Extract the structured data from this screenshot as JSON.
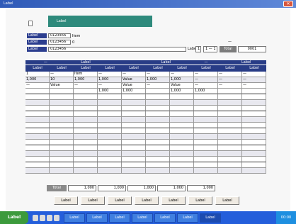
{
  "titlebar": {
    "title": "Label",
    "close_label": "✕"
  },
  "banner": {
    "text": "Label"
  },
  "fields": [
    {
      "label": "Label",
      "value": "0123456",
      "suffix": "Item"
    },
    {
      "label": "Label",
      "value": "0123456",
      "suffix": "0"
    },
    {
      "label": "Label",
      "value": "0123456",
      "suffix": ""
    }
  ],
  "right_info": {
    "page_label": "Label",
    "range_label": "1",
    "range_value": "1 — 1",
    "total_label": "Total",
    "total_value": "0001"
  },
  "right_note": "—",
  "grid": {
    "header1": [
      "—",
      "Label",
      "",
      "Label",
      "—",
      "Label"
    ],
    "header2": [
      "Label",
      "Label",
      "Label",
      "Label",
      "Label",
      "Label",
      "Label",
      "Label",
      "Label",
      "Label"
    ],
    "rows": [
      [
        "1",
        "—",
        "Item",
        "—",
        "—",
        "—",
        "—",
        "—",
        "—",
        "—"
      ],
      [
        "1,000",
        "10",
        "1,000",
        "1,000",
        "Value",
        "1,000",
        "1,000",
        "—",
        "—",
        "—"
      ],
      [
        "—",
        "Value",
        "—",
        "—",
        "Value",
        "—",
        "Value",
        "—",
        "—",
        "—"
      ],
      [
        "",
        "",
        "",
        "1,000",
        "1,000",
        "",
        "1,000",
        "1,000",
        "",
        ""
      ]
    ]
  },
  "totals": {
    "label": "Total",
    "values": [
      "1,000",
      "1,000",
      "1,000",
      "1,000",
      "1,000"
    ]
  },
  "buttons": [
    "Label",
    "Label",
    "Label",
    "Label",
    "Label",
    "Label",
    "Label"
  ],
  "taskbar": {
    "start_label": "Label",
    "tasks": [
      "Label",
      "Label",
      "Label",
      "Label",
      "Label",
      "Label",
      "Label"
    ],
    "clock": "00:00"
  },
  "colors": {
    "banner": "#2e8a7c",
    "header": "#283c86",
    "label": "#2c3e8f",
    "taskbar": "#245edb"
  }
}
